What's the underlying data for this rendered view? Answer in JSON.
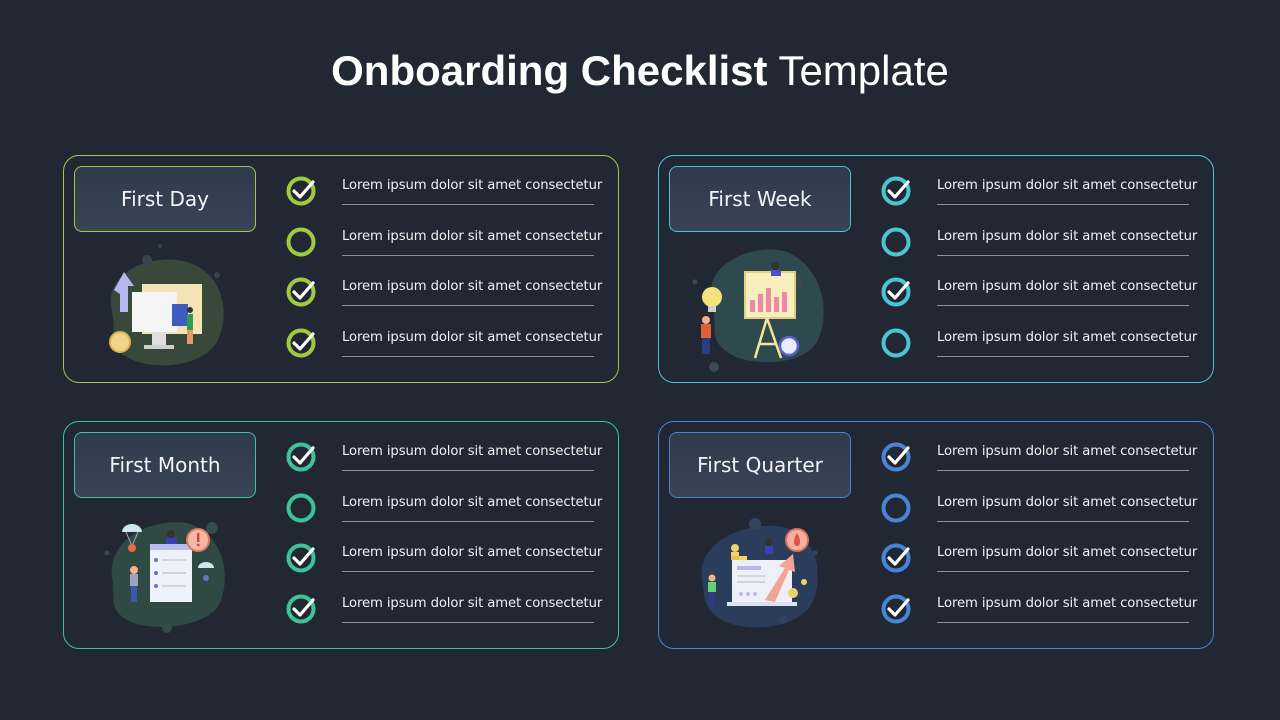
{
  "page": {
    "title_bold": "Onboarding Checklist",
    "title_light": "Template"
  },
  "cards": [
    {
      "label": "First Day",
      "accent": "#9fca3e",
      "illustration": "growth-computer-illustration",
      "items": [
        {
          "text": "Lorem ipsum dolor sit amet consectetur",
          "checked": true
        },
        {
          "text": "Lorem ipsum dolor sit amet consectetur",
          "checked": false
        },
        {
          "text": "Lorem ipsum dolor sit amet consectetur",
          "checked": true
        },
        {
          "text": "Lorem ipsum dolor sit amet consectetur",
          "checked": true
        }
      ]
    },
    {
      "label": "First Week",
      "accent": "#4dc4d2",
      "illustration": "presentation-board-illustration",
      "items": [
        {
          "text": "Lorem ipsum dolor sit amet consectetur",
          "checked": true
        },
        {
          "text": "Lorem ipsum dolor sit amet consectetur",
          "checked": false
        },
        {
          "text": "Lorem ipsum dolor sit amet consectetur",
          "checked": true
        },
        {
          "text": "Lorem ipsum dolor sit amet consectetur",
          "checked": false
        }
      ]
    },
    {
      "label": "First Month",
      "accent": "#3ec29a",
      "illustration": "checklist-document-illustration",
      "items": [
        {
          "text": "Lorem ipsum dolor sit amet consectetur",
          "checked": true
        },
        {
          "text": "Lorem ipsum dolor sit amet consectetur",
          "checked": false
        },
        {
          "text": "Lorem ipsum dolor sit amet consectetur",
          "checked": true
        },
        {
          "text": "Lorem ipsum dolor sit amet consectetur",
          "checked": true
        }
      ]
    },
    {
      "label": "First Quarter",
      "accent": "#4a84d6",
      "illustration": "laptop-growth-illustration",
      "items": [
        {
          "text": "Lorem ipsum dolor sit amet consectetur",
          "checked": true
        },
        {
          "text": "Lorem ipsum dolor sit amet consectetur",
          "checked": false
        },
        {
          "text": "Lorem ipsum dolor sit amet consectetur",
          "checked": true
        },
        {
          "text": "Lorem ipsum dolor sit amet consectetur",
          "checked": true
        }
      ]
    }
  ]
}
